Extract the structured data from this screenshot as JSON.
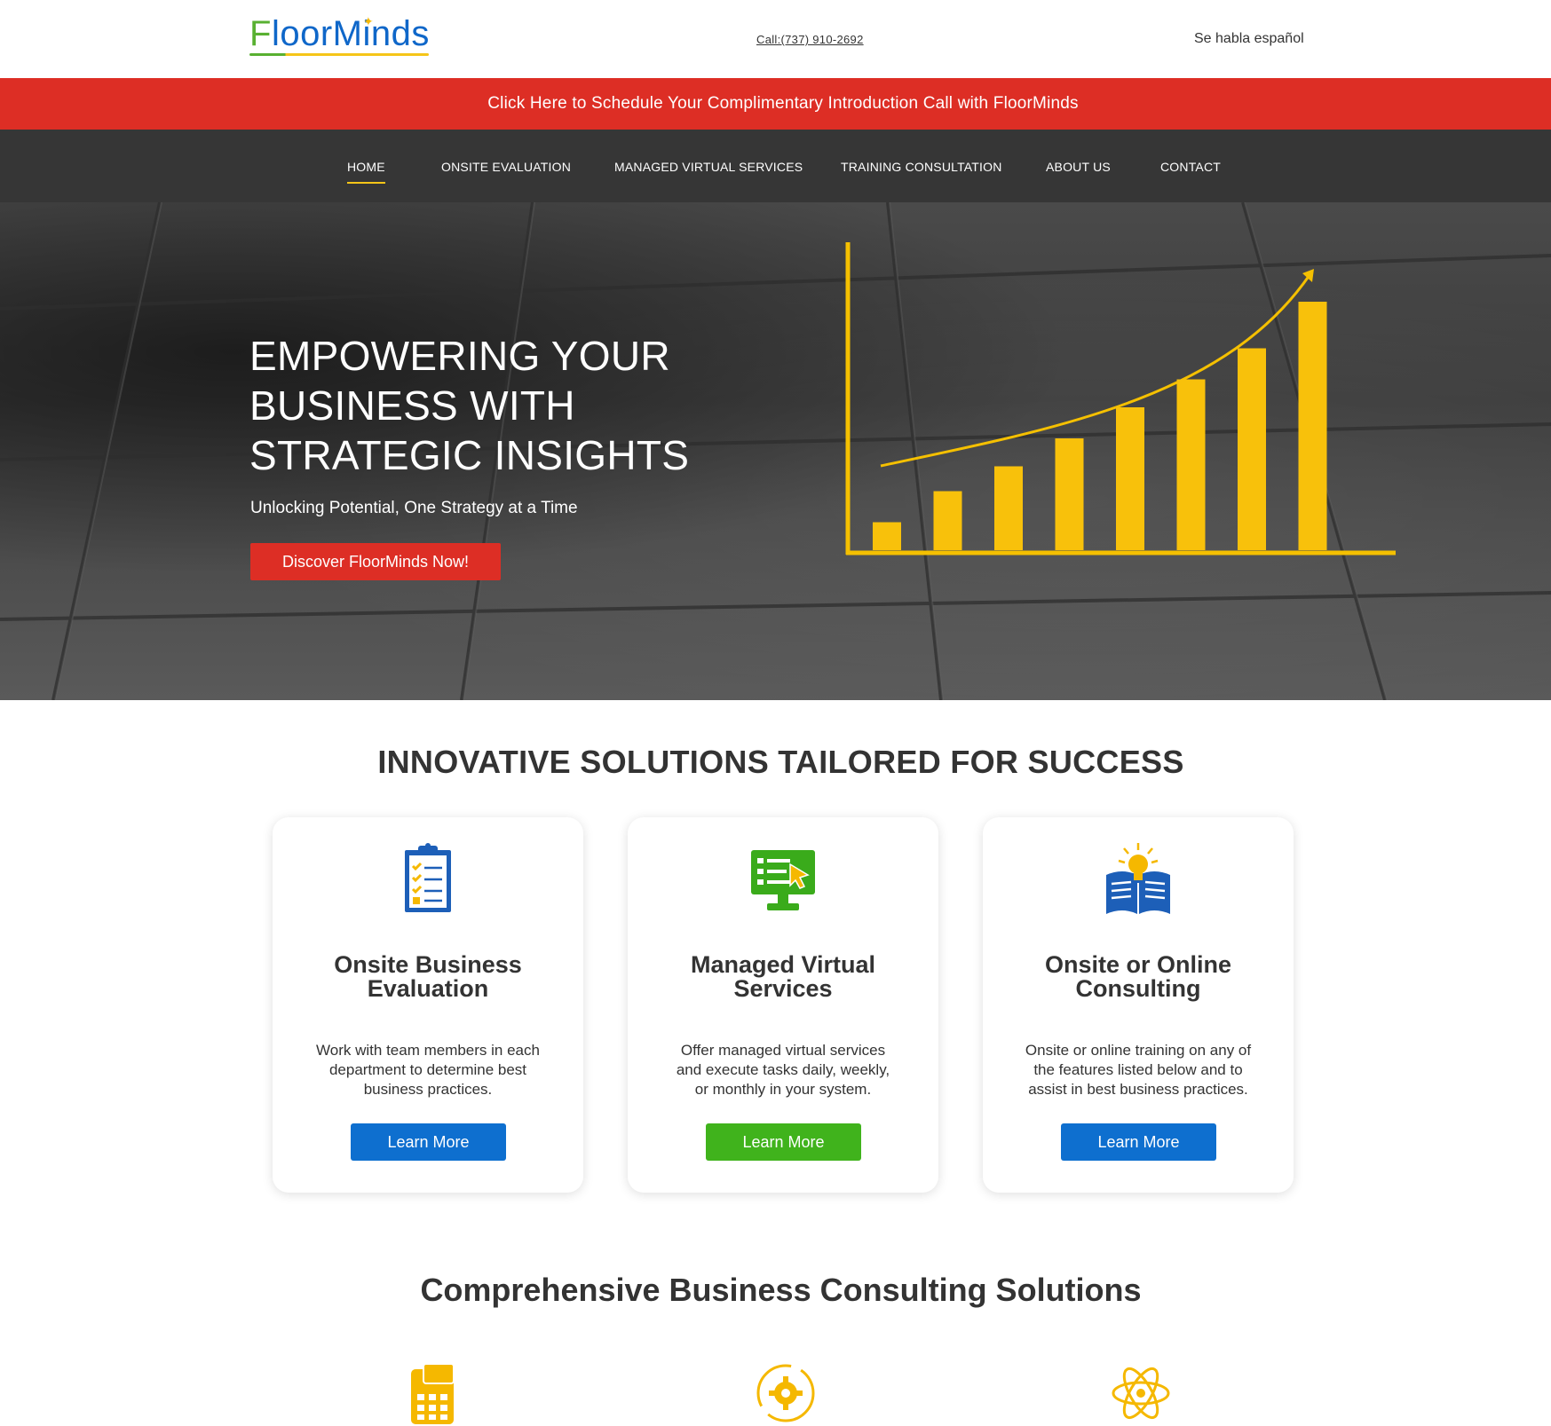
{
  "header": {
    "logo": {
      "part1": "F",
      "part2": "loor",
      "part3": "Minds"
    },
    "phone": "Call:(737) 910-2692",
    "spanish": "Se habla español"
  },
  "promo_banner": "Click Here to Schedule Your Complimentary Introduction Call with FloorMinds",
  "nav": {
    "items": [
      {
        "label": "HOME",
        "active": true
      },
      {
        "label": "ONSITE EVALUATION"
      },
      {
        "label": "MANAGED VIRTUAL SERVICES"
      },
      {
        "label": "TRAINING CONSULTATION"
      },
      {
        "label": "ABOUT US"
      },
      {
        "label": "CONTACT"
      }
    ]
  },
  "hero": {
    "title_line1": "EMPOWERING YOUR",
    "title_line2": "BUSINESS WITH",
    "title_line3": "STRATEGIC INSIGHTS",
    "subtitle": "Unlocking Potential, One Strategy at a Time",
    "cta": "Discover FloorMinds Now!",
    "graphic_bar_levels": [
      0.09,
      0.19,
      0.27,
      0.36,
      0.46,
      0.55,
      0.65,
      0.8
    ]
  },
  "solutions": {
    "title": "INNOVATIVE SOLUTIONS TAILORED FOR SUCCESS",
    "cards": [
      {
        "icon": "clipboard-checklist-icon",
        "title_line1": "Onsite Business",
        "title_line2": "Evaluation",
        "desc_line1": "Work with team members in each",
        "desc_line2": "department to determine best",
        "desc_line3": "business practices.",
        "button": "Learn More",
        "button_color": "#0e6fcf"
      },
      {
        "icon": "monitor-cursor-icon",
        "title_line1": "Managed Virtual",
        "title_line2": "Services",
        "desc_line1": "Offer managed virtual services",
        "desc_line2": "and execute tasks daily, weekly,",
        "desc_line3": "or monthly in your system.",
        "button": "Learn More",
        "button_color": "#40b31c"
      },
      {
        "icon": "book-lightbulb-icon",
        "title_line1": "Onsite or Online",
        "title_line2": "Consulting",
        "desc_line1": "Onsite or online training on any of",
        "desc_line2": "the features listed below and to",
        "desc_line3": "assist in best business practices.",
        "button": "Learn More",
        "button_color": "#0e6fcf"
      }
    ]
  },
  "consulting": {
    "title": "Comprehensive Business Consulting Solutions",
    "icons": [
      "calculator-icon",
      "gear-cycle-icon",
      "atom-icon"
    ]
  },
  "colors": {
    "brand_red": "#dd2e25",
    "nav_bg": "#363636",
    "accent_yellow": "#f5c518",
    "brand_blue": "#0e6fcf",
    "brand_green": "#40b31c"
  }
}
